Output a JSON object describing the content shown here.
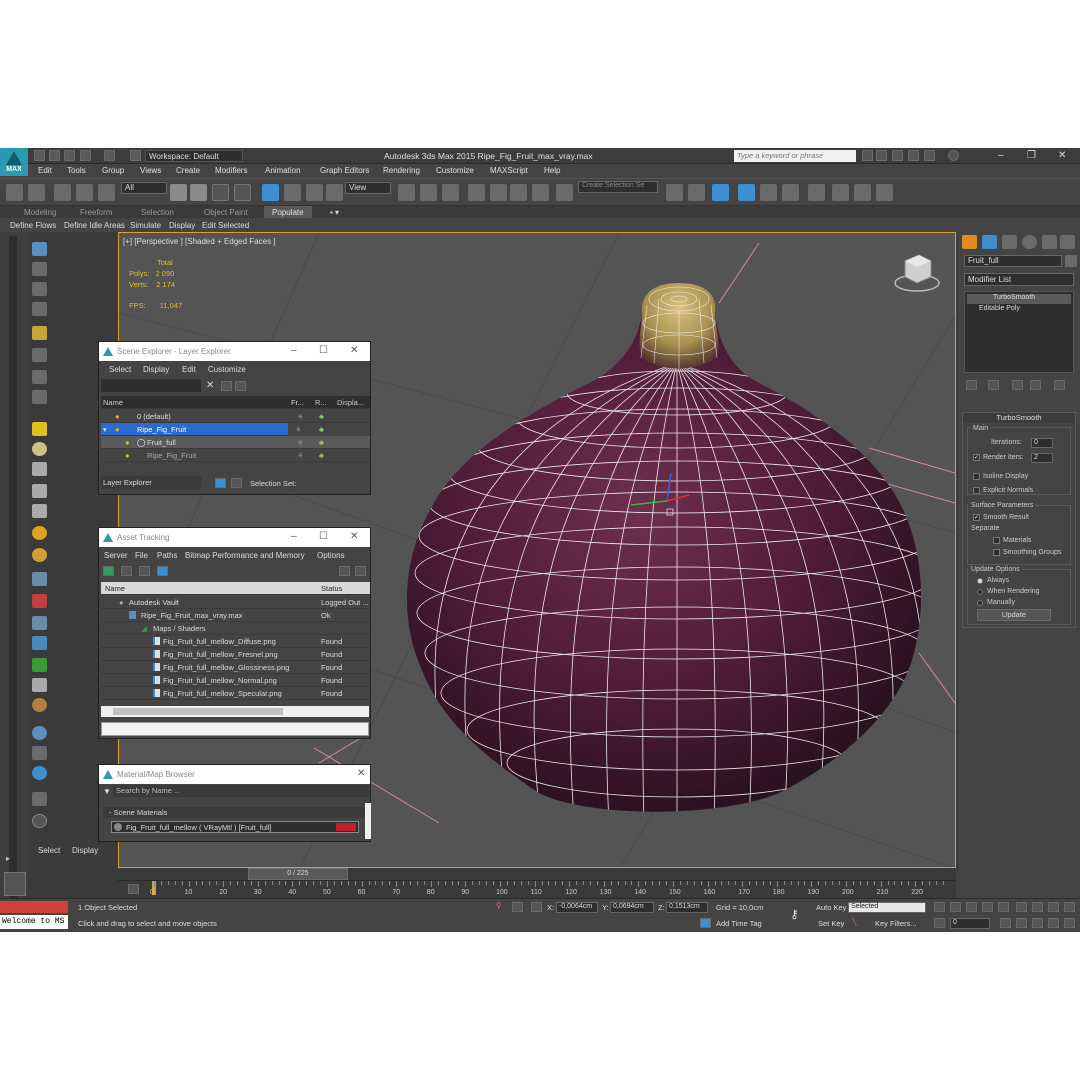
{
  "titlebar": {
    "workspace": "Workspace: Default",
    "title": "Autodesk 3ds Max  2015     Ripe_Fig_Fruit_max_vray.max",
    "search_placeholder": "Type a keyword or phrase",
    "logo_text": "MAX"
  },
  "menu": [
    "Edit",
    "Tools",
    "Group",
    "Views",
    "Create",
    "Modifiers",
    "Animation",
    "Graph Editors",
    "Rendering",
    "Customize",
    "MAXScript",
    "Help"
  ],
  "toolbar": {
    "selection_filter": "All",
    "ref_coord": "View",
    "selection_set": "Create Selection Se"
  },
  "ribbon": {
    "tabs": [
      "Modeling",
      "Freeform",
      "Selection",
      "Object Paint",
      "Populate"
    ],
    "active_tab": "Populate",
    "row2": [
      "Define Flows",
      "Define Idle Areas",
      "Simulate",
      "Display",
      "Edit Selected"
    ]
  },
  "left_panel": {
    "select": "Select",
    "display": "Display"
  },
  "viewport": {
    "label": "[+] [Perspective ] [Shaded + Edged Faces ]",
    "stats_total": "Total",
    "polys_label": "Polys:",
    "polys_value": "2 090",
    "verts_label": "Verts:",
    "verts_value": "2 174",
    "fps_label": "FPS:",
    "fps_value": "11,047"
  },
  "command_panel": {
    "object_name": "Fruit_full",
    "modifier_list": "Modifier List",
    "stack": [
      "TurboSmooth",
      "Editable Poly"
    ],
    "rollout_title": "TurboSmooth",
    "main": "Main",
    "iterations_label": "Iterations:",
    "iterations_value": "0",
    "render_iters_label": "Render Iters:",
    "render_iters_value": "2",
    "isoline": "Isoline Display",
    "explicit": "Explicit Normals",
    "surface_params": "Surface Parameters",
    "smooth_result": "Smooth Result",
    "separate": "Separate",
    "materials": "Materials",
    "smoothing_groups": "Smoothing Groups",
    "update_options": "Update Options",
    "always": "Always",
    "when_rendering": "When Rendering",
    "manually": "Manually",
    "update_button": "Update"
  },
  "scene_explorer": {
    "title": "Scene Explorer - Layer Explorer",
    "menu": [
      "Select",
      "Display",
      "Edit",
      "Customize"
    ],
    "col_name": "Name",
    "col_fr": "Fr...",
    "col_r": "R...",
    "col_disp": "Displa...",
    "rows": [
      "0 (default)",
      "Ripe_Fig_Fruit",
      "Fruit_full",
      "Ripe_Fig_Fruit"
    ],
    "footer_dropdown": "Layer Explorer",
    "footer_selset": "Selection Set:"
  },
  "asset_tracking": {
    "title": "Asset Tracking",
    "menu": [
      "Server",
      "File",
      "Paths",
      "Bitmap Performance and Memory",
      "Options"
    ],
    "col_name": "Name",
    "col_status": "Status",
    "rows": [
      {
        "name": "Autodesk Vault",
        "status": "Logged Out ..."
      },
      {
        "name": "Ripe_Fig_Fruit_max_vray.max",
        "status": "Ok"
      },
      {
        "name": "Maps / Shaders",
        "status": ""
      },
      {
        "name": "Fig_Fruit_full_mellow_Diffuse.png",
        "status": "Found"
      },
      {
        "name": "Fig_Fruit_full_mellow_Fresnel.png",
        "status": "Found"
      },
      {
        "name": "Fig_Fruit_full_mellow_Glossiness.png",
        "status": "Found"
      },
      {
        "name": "Fig_Fruit_full_mellow_Normal.png",
        "status": "Found"
      },
      {
        "name": "Fig_Fruit_full_mellow_Specular.png",
        "status": "Found"
      }
    ]
  },
  "material_browser": {
    "title": "Material/Map Browser",
    "search_placeholder": "Search by Name ...",
    "group": "- Scene Materials",
    "material": "Fig_Fruit_full_mellow  ( VRayMtl )  [Fruit_full]"
  },
  "timeline": {
    "slider": "0 / 225",
    "ticks": [
      "0",
      "10",
      "20",
      "30",
      "40",
      "50",
      "60",
      "70",
      "80",
      "90",
      "100",
      "110",
      "120",
      "130",
      "140",
      "150",
      "160",
      "170",
      "180",
      "190",
      "200",
      "210",
      "220"
    ]
  },
  "status": {
    "maxscript": "Welcome to MS",
    "selected": "1 Object Selected",
    "prompt": "Click and drag to select and move objects",
    "x_label": "X:",
    "x_value": "-0,0064cm",
    "y_label": "Y:",
    "y_value": "0,0694cm",
    "z_label": "Z:",
    "z_value": "0,1513cm",
    "grid": "Grid = 10,0cm",
    "add_time_tag": "Add Time Tag",
    "auto_key": "Auto Key",
    "selected_dropdown": "Selected",
    "set_key": "Set Key",
    "key_filters": "Key Filters...",
    "frame": "0"
  },
  "colors": {
    "accent_blue": "#3d8fcf",
    "viewport_border": "#d6a42a",
    "fig_purple": "#5a2140",
    "stats_yellow": "#e0c020"
  }
}
